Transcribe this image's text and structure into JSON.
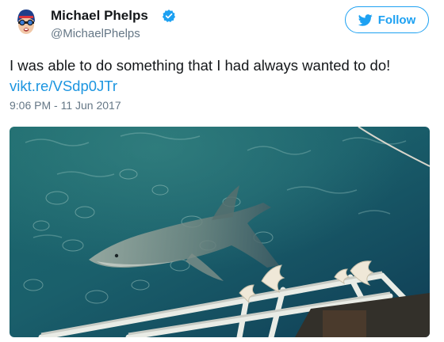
{
  "author": {
    "display_name": "Michael Phelps",
    "handle": "@MichaelPhelps",
    "verified": true,
    "avatar_icon": "avatar-swimmer-icon"
  },
  "follow_button": {
    "label": "Follow",
    "icon": "bird-icon",
    "color": "#1da1f2"
  },
  "tweet": {
    "text": "I was able to do something that I had always wanted to do!",
    "link": "vikt.re/VSdp0JTr",
    "timestamp": "9:06 PM - 11 Jun 2017"
  },
  "colors": {
    "text": "#14171a",
    "secondary": "#657786",
    "link": "#1b95e0",
    "verified": "#1da1f2"
  },
  "media": {
    "subject": "shark-photo"
  }
}
